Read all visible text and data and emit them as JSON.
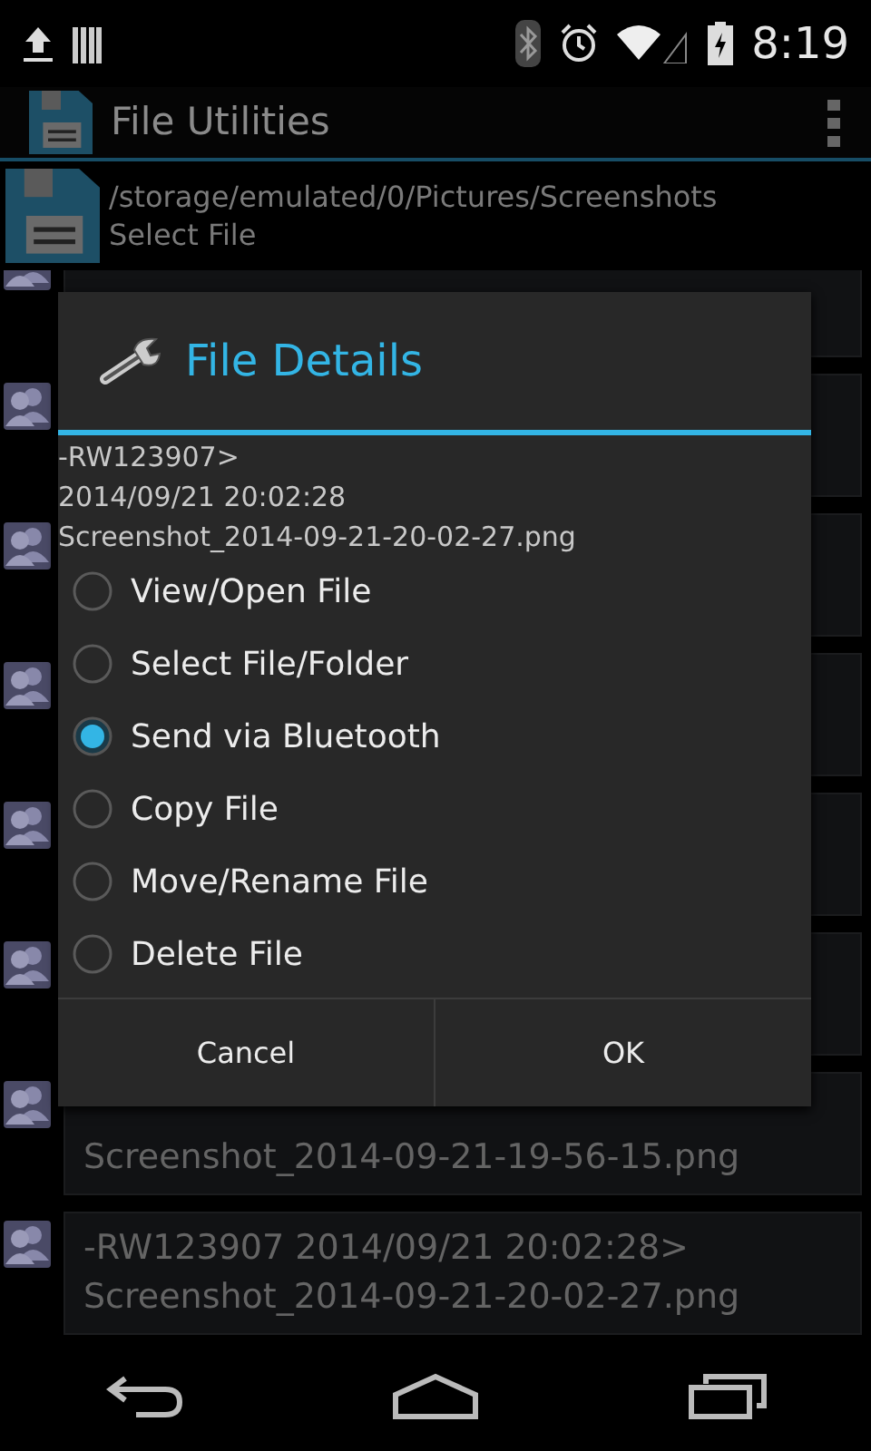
{
  "status_bar": {
    "time": "8:19"
  },
  "action_bar": {
    "title": "File Utilities"
  },
  "location": {
    "path": "/storage/emulated/0/Pictures/Screenshots",
    "mode": "Select File"
  },
  "files": [
    {
      "kind": "covered"
    },
    {
      "kind": "covered"
    },
    {
      "kind": "covered"
    },
    {
      "kind": "covered"
    },
    {
      "kind": "covered"
    },
    {
      "kind": "covered"
    },
    {
      "kind": "file",
      "lines": [
        "Screenshot_2014-09-21-19-56-15.png"
      ]
    },
    {
      "kind": "file",
      "lines": [
        "-RW123907 2014/09/21 20:02:28>",
        "Screenshot_2014-09-21-20-02-27.png"
      ]
    }
  ],
  "dialog": {
    "title": "File Details",
    "details": [
      "-RW123907>",
      "2014/09/21 20:02:28",
      "Screenshot_2014-09-21-20-02-27.png"
    ],
    "options": [
      {
        "label": "View/Open File",
        "selected": false
      },
      {
        "label": "Select File/Folder",
        "selected": false
      },
      {
        "label": "Send via Bluetooth",
        "selected": true
      },
      {
        "label": "Copy File",
        "selected": false
      },
      {
        "label": "Move/Rename File",
        "selected": false
      },
      {
        "label": "Delete File",
        "selected": false
      }
    ],
    "buttons": [
      "Cancel",
      "OK"
    ]
  }
}
